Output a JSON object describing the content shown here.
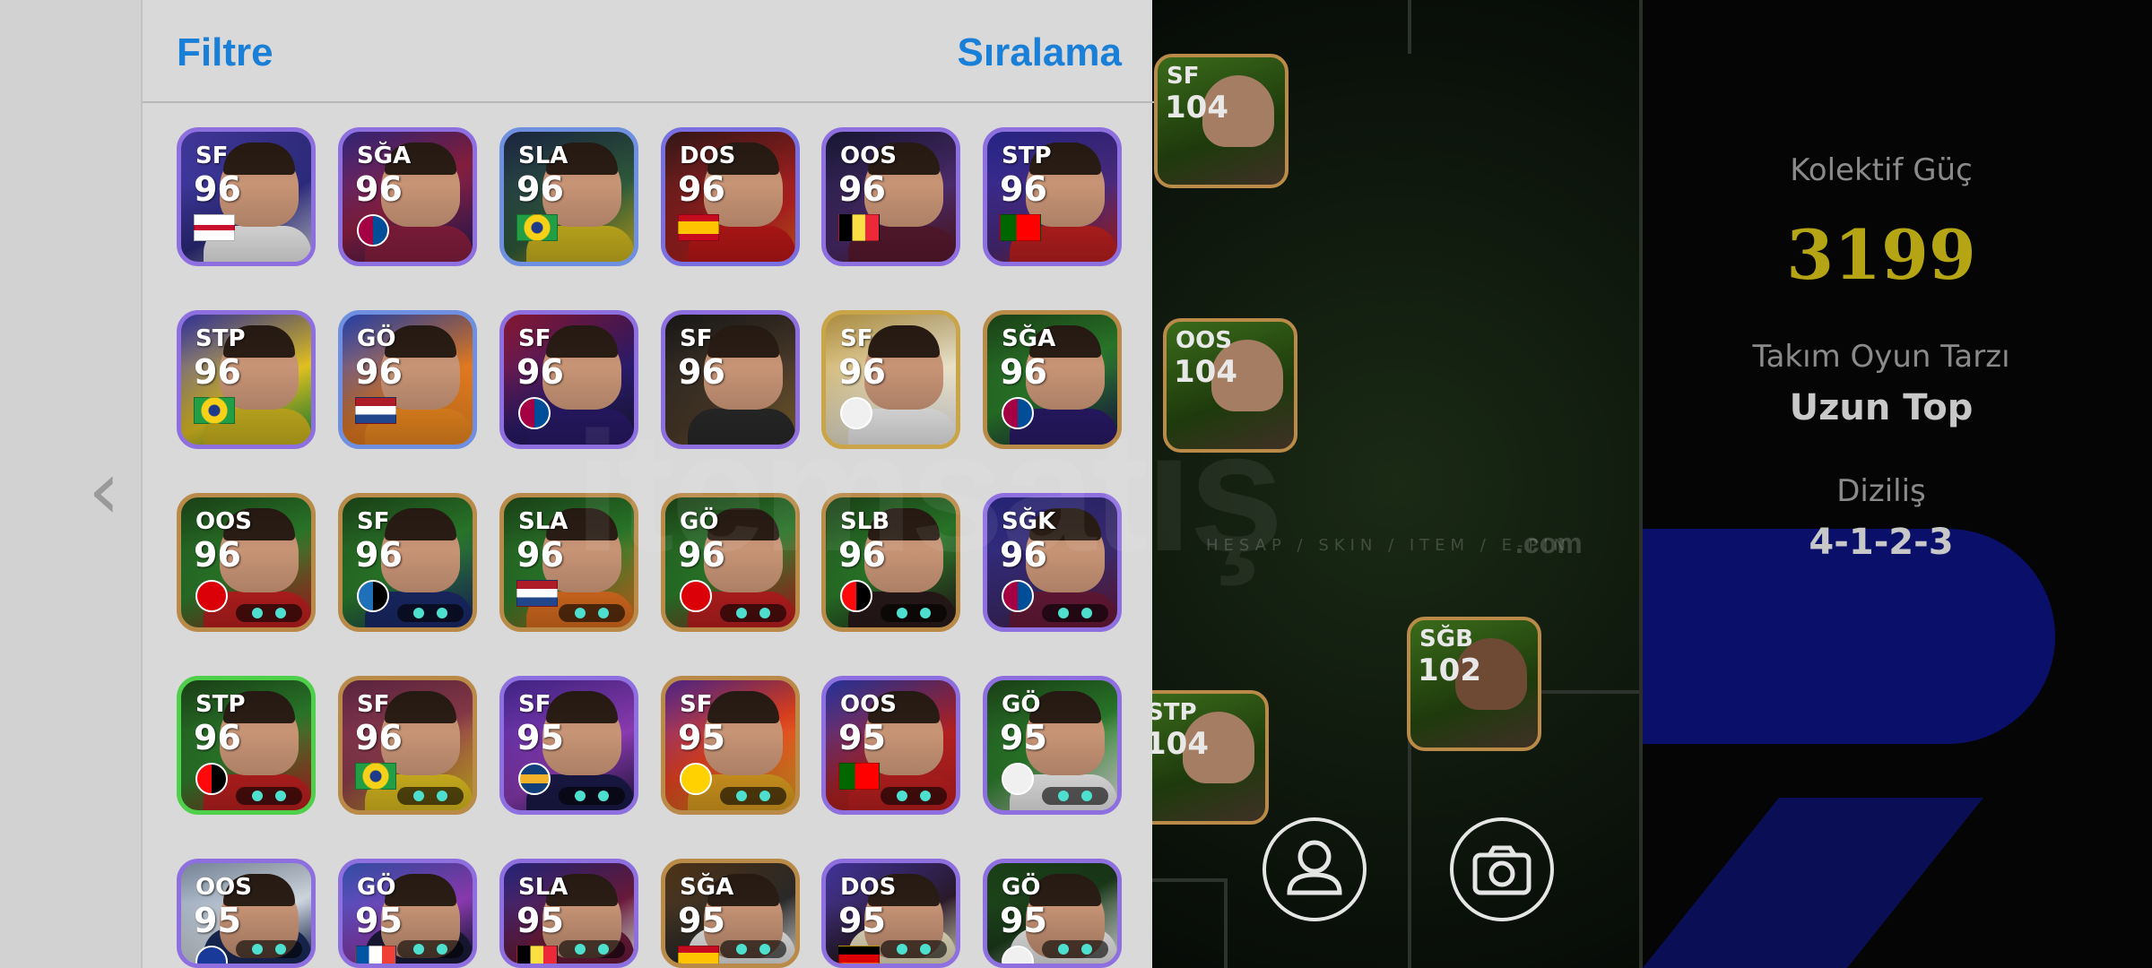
{
  "panel": {
    "filter_label": "Filtre",
    "sort_label": "Sıralama"
  },
  "team_info": {
    "power_label": "Kolektif Güç",
    "power_value": "3199",
    "style_label": "Takım Oyun Tarzı",
    "style_value": "Uzun Top",
    "formation_label": "Diziliş",
    "formation_value": "4-1-2-3"
  },
  "watermark": {
    "text": "itemsatış",
    "sub": "HESAP / SKIN / ITEM / E-PIN",
    "com": ".com"
  },
  "player_cards": [
    {
      "pos": "SF",
      "rating": "96",
      "flag": "england"
    },
    {
      "pos": "SĞA",
      "rating": "96",
      "flag": "barcelona"
    },
    {
      "pos": "SLA",
      "rating": "96",
      "flag": "brazil"
    },
    {
      "pos": "DOS",
      "rating": "96",
      "flag": "spain"
    },
    {
      "pos": "OOS",
      "rating": "96",
      "flag": "belgium"
    },
    {
      "pos": "STP",
      "rating": "96",
      "flag": "portugal"
    },
    {
      "pos": "STP",
      "rating": "96",
      "flag": "brazil"
    },
    {
      "pos": "GÖ",
      "rating": "96",
      "flag": "netherlands"
    },
    {
      "pos": "SF",
      "rating": "96",
      "flag": "barcelona"
    },
    {
      "pos": "SF",
      "rating": "96",
      "flag": "none"
    },
    {
      "pos": "SF",
      "rating": "96",
      "flag": "real-madrid"
    },
    {
      "pos": "SĞA",
      "rating": "96",
      "flag": "barcelona"
    },
    {
      "pos": "OOS",
      "rating": "96",
      "flag": "arsenal"
    },
    {
      "pos": "SF",
      "rating": "96",
      "flag": "atalanta"
    },
    {
      "pos": "SLA",
      "rating": "96",
      "flag": "netherlands"
    },
    {
      "pos": "GÖ",
      "rating": "96",
      "flag": "arsenal"
    },
    {
      "pos": "SLB",
      "rating": "96",
      "flag": "milan"
    },
    {
      "pos": "SĞK",
      "rating": "96",
      "flag": "barcelona"
    },
    {
      "pos": "STP",
      "rating": "96",
      "flag": "milan"
    },
    {
      "pos": "SF",
      "rating": "96",
      "flag": "brazil"
    },
    {
      "pos": "SF",
      "rating": "95",
      "flag": "boca"
    },
    {
      "pos": "SF",
      "rating": "95",
      "flag": "america"
    },
    {
      "pos": "OOS",
      "rating": "95",
      "flag": "portugal"
    },
    {
      "pos": "GÖ",
      "rating": "95",
      "flag": "real-madrid"
    },
    {
      "pos": "OOS",
      "rating": "95",
      "flag": "inter"
    },
    {
      "pos": "GÖ",
      "rating": "95",
      "flag": "france"
    },
    {
      "pos": "SLA",
      "rating": "95",
      "flag": "belgium"
    },
    {
      "pos": "SĞA",
      "rating": "95",
      "flag": "spain"
    },
    {
      "pos": "DOS",
      "rating": "95",
      "flag": "germany"
    },
    {
      "pos": "GÖ",
      "rating": "95",
      "flag": "real-madrid"
    }
  ],
  "field_cards": [
    {
      "pos": "SF",
      "rating": "104"
    },
    {
      "pos": "OOS",
      "rating": "104"
    },
    {
      "pos": "SĞB",
      "rating": "102"
    },
    {
      "pos": "STP",
      "rating": "104"
    }
  ],
  "icons": {
    "back": "chevron-left-icon",
    "profile": "user-icon",
    "camera": "camera-icon"
  }
}
